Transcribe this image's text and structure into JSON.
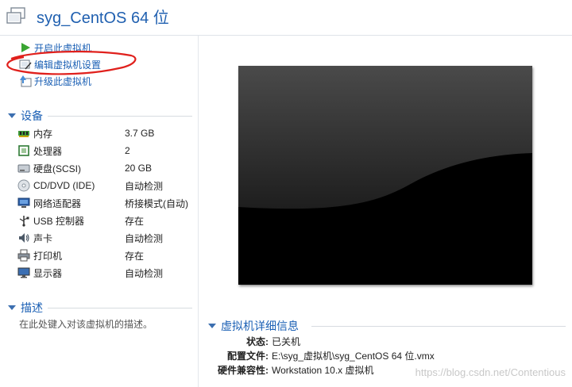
{
  "title": "syg_CentOS 64 位",
  "actions": [
    {
      "label": "开启此虚拟机",
      "icon": "play-icon"
    },
    {
      "label": "编辑虚拟机设置",
      "icon": "edit-settings-icon"
    },
    {
      "label": "升级此虚拟机",
      "icon": "upgrade-icon"
    }
  ],
  "devices": {
    "heading": "设备",
    "items": [
      {
        "name": "内存",
        "value": "3.7 GB",
        "icon": "memory-icon"
      },
      {
        "name": "处理器",
        "value": "2",
        "icon": "processor-icon"
      },
      {
        "name": "硬盘(SCSI)",
        "value": "20 GB",
        "icon": "hard-disk-icon"
      },
      {
        "name": "CD/DVD (IDE)",
        "value": "自动检测",
        "icon": "cd-dvd-icon"
      },
      {
        "name": "网络适配器",
        "value": "桥接模式(自动)",
        "icon": "network-adapter-icon"
      },
      {
        "name": "USB 控制器",
        "value": "存在",
        "icon": "usb-icon"
      },
      {
        "name": "声卡",
        "value": "自动检测",
        "icon": "sound-card-icon"
      },
      {
        "name": "打印机",
        "value": "存在",
        "icon": "printer-icon"
      },
      {
        "name": "显示器",
        "value": "自动检测",
        "icon": "display-icon"
      }
    ]
  },
  "description": {
    "heading": "描述",
    "placeholder": "在此处键入对该虚拟机的描述。"
  },
  "details": {
    "heading": "虚拟机详细信息",
    "rows": [
      {
        "label": "状态:",
        "value": "已关机"
      },
      {
        "label": "配置文件:",
        "value": "E:\\syg_虚拟机\\syg_CentOS 64 位.vmx"
      },
      {
        "label": "硬件兼容性:",
        "value": "Workstation 10.x 虚拟机"
      }
    ]
  },
  "watermark": "https://blog.csdn.net/Contentious",
  "colors": {
    "link": "#1a5fb4",
    "annotation": "#e0201c",
    "play": "#3aa532"
  }
}
